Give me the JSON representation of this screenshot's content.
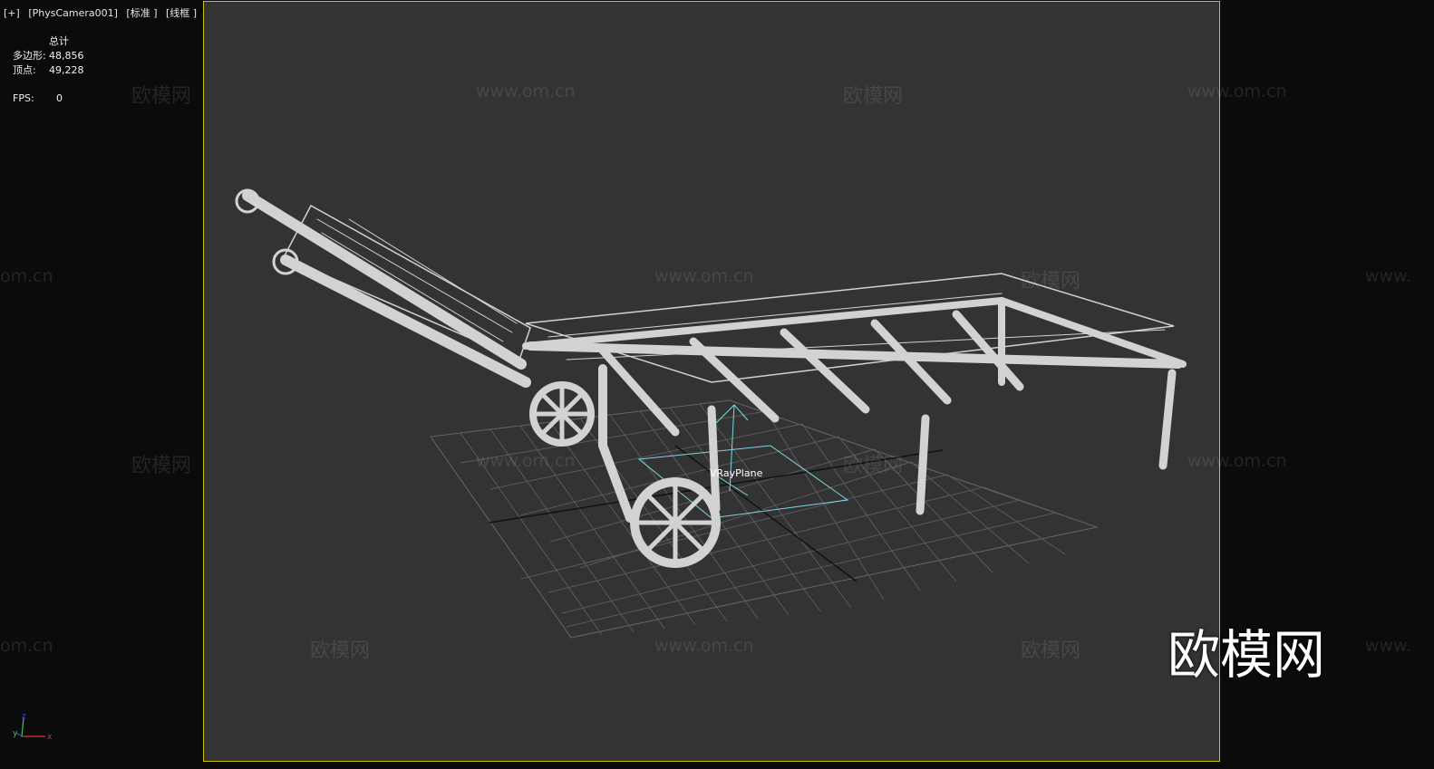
{
  "viewport": {
    "label_parts": [
      "[+]",
      "[PhysCamera001]",
      "[标准 ]",
      "[线框 ]"
    ],
    "border_color": "#c9c000",
    "background": "#333333"
  },
  "stats": {
    "header": "总计",
    "polygons_label": "多边形:",
    "polygons_value": "48,856",
    "vertices_label": "顶点:",
    "vertices_value": "49,228",
    "fps_label": "FPS:",
    "fps_value": "0"
  },
  "scene": {
    "object_label": "VRayPlane",
    "wire_color": "#d2d2d2",
    "selection_color": "#7fd7e0"
  },
  "watermarks": {
    "brand": "欧模网",
    "url": "www.om.cn",
    "url_cut": "om.cn",
    "url_start": "www."
  },
  "logo": "欧模网",
  "axis": {
    "x": "x",
    "y": "y",
    "z": "z"
  }
}
